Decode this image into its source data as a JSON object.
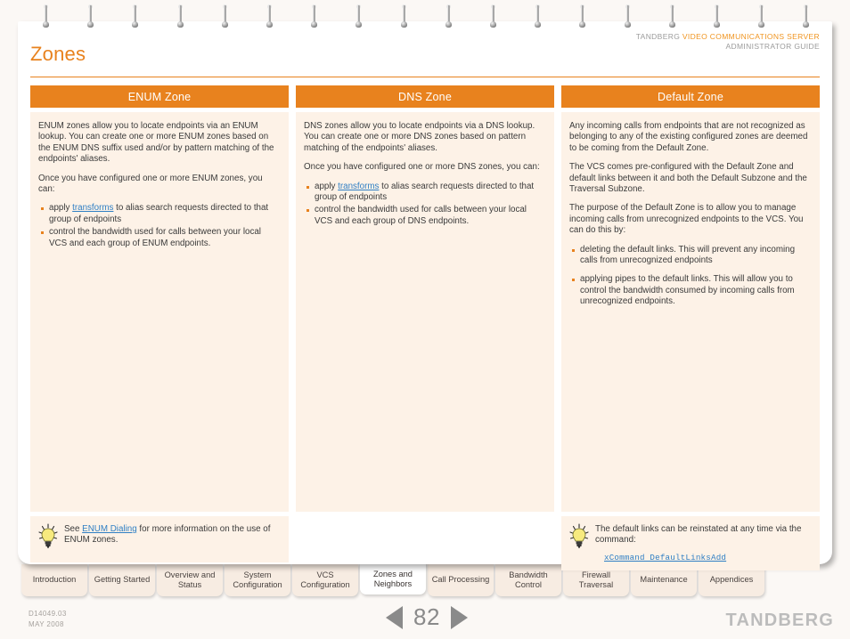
{
  "document": {
    "title": "Zones",
    "guide_brand": "TANDBERG ",
    "guide_product": "VIDEO COMMUNICATIONS SERVER",
    "guide_subtitle": "ADMINISTRATOR GUIDE",
    "accent_color": "#e8821e",
    "panel_color": "#fdf2e7",
    "link_color": "#2f7fc4"
  },
  "columns": [
    {
      "heading": "ENUM Zone",
      "paragraphs": [
        "ENUM zones allow you to locate endpoints via an ENUM lookup. You can create one or more ENUM zones based on the ENUM DNS suffix used and/or by pattern matching of the endpoints' aliases.",
        "Once you have configured one or more ENUM zones, you can:"
      ],
      "bullets": [
        {
          "pre": "apply ",
          "link": "transforms",
          "post": " to alias search requests directed to that group of endpoints"
        },
        {
          "pre": "control the bandwidth used for calls between your local VCS and each group of ENUM endpoints.",
          "link": "",
          "post": ""
        }
      ],
      "tip": {
        "present": true,
        "pre": "See ",
        "link": "ENUM Dialing",
        "post": " for more information on the use of ENUM zones.",
        "command": ""
      }
    },
    {
      "heading": "DNS Zone",
      "paragraphs": [
        "DNS zones allow you to locate endpoints via a  DNS lookup.  You can create one or more DNS zones based on pattern matching of the endpoints' aliases.",
        "Once you have configured one or more DNS zones, you can:"
      ],
      "bullets": [
        {
          "pre": "apply ",
          "link": "transforms",
          "post": " to alias search requests directed to that group of endpoints"
        },
        {
          "pre": "control the bandwidth used for calls between your local VCS and each group of DNS endpoints.",
          "link": "",
          "post": ""
        }
      ],
      "tip": {
        "present": false,
        "pre": "",
        "link": "",
        "post": "",
        "command": ""
      }
    },
    {
      "heading": "Default Zone",
      "paragraphs": [
        "Any incoming calls from endpoints that are not recognized as belonging to any of the existing configured zones are deemed to be coming from the Default Zone.",
        "The VCS comes pre-configured with the Default Zone and default links between it and both the Default Subzone and the Traversal Subzone.",
        "The purpose of the Default Zone is to allow you to manage incoming calls from unrecognized endpoints to the VCS.  You can do this by:"
      ],
      "bullets": [
        {
          "pre": "deleting the default links.  This will prevent any incoming calls from unrecognized endpoints",
          "link": "",
          "post": ""
        },
        {
          "pre": "applying pipes to the default links.  This will allow you to control the bandwidth consumed by incoming calls from unrecognized endpoints.",
          "link": "",
          "post": ""
        }
      ],
      "tip": {
        "present": true,
        "pre": "The default links can be reinstated at any time via the command:",
        "link": "",
        "post": "",
        "command": "xCommand DefaultLinksAdd"
      }
    }
  ],
  "tabs": [
    {
      "label": "Introduction",
      "active": false
    },
    {
      "label": "Getting Started",
      "active": false
    },
    {
      "label": "Overview and Status",
      "active": false
    },
    {
      "label": "System Configuration",
      "active": false
    },
    {
      "label": "VCS Configuration",
      "active": false
    },
    {
      "label": "Zones and Neighbors",
      "active": true
    },
    {
      "label": "Call Processing",
      "active": false
    },
    {
      "label": "Bandwidth Control",
      "active": false
    },
    {
      "label": "Firewall Traversal",
      "active": false
    },
    {
      "label": "Maintenance",
      "active": false
    },
    {
      "label": "Appendices",
      "active": false
    }
  ],
  "footer": {
    "doc_id": "D14049.03",
    "doc_date": "MAY 2008",
    "page_number": "82",
    "prev_icon": "left-triangle-icon",
    "next_icon": "right-triangle-icon",
    "brand": "TANDBERG"
  }
}
